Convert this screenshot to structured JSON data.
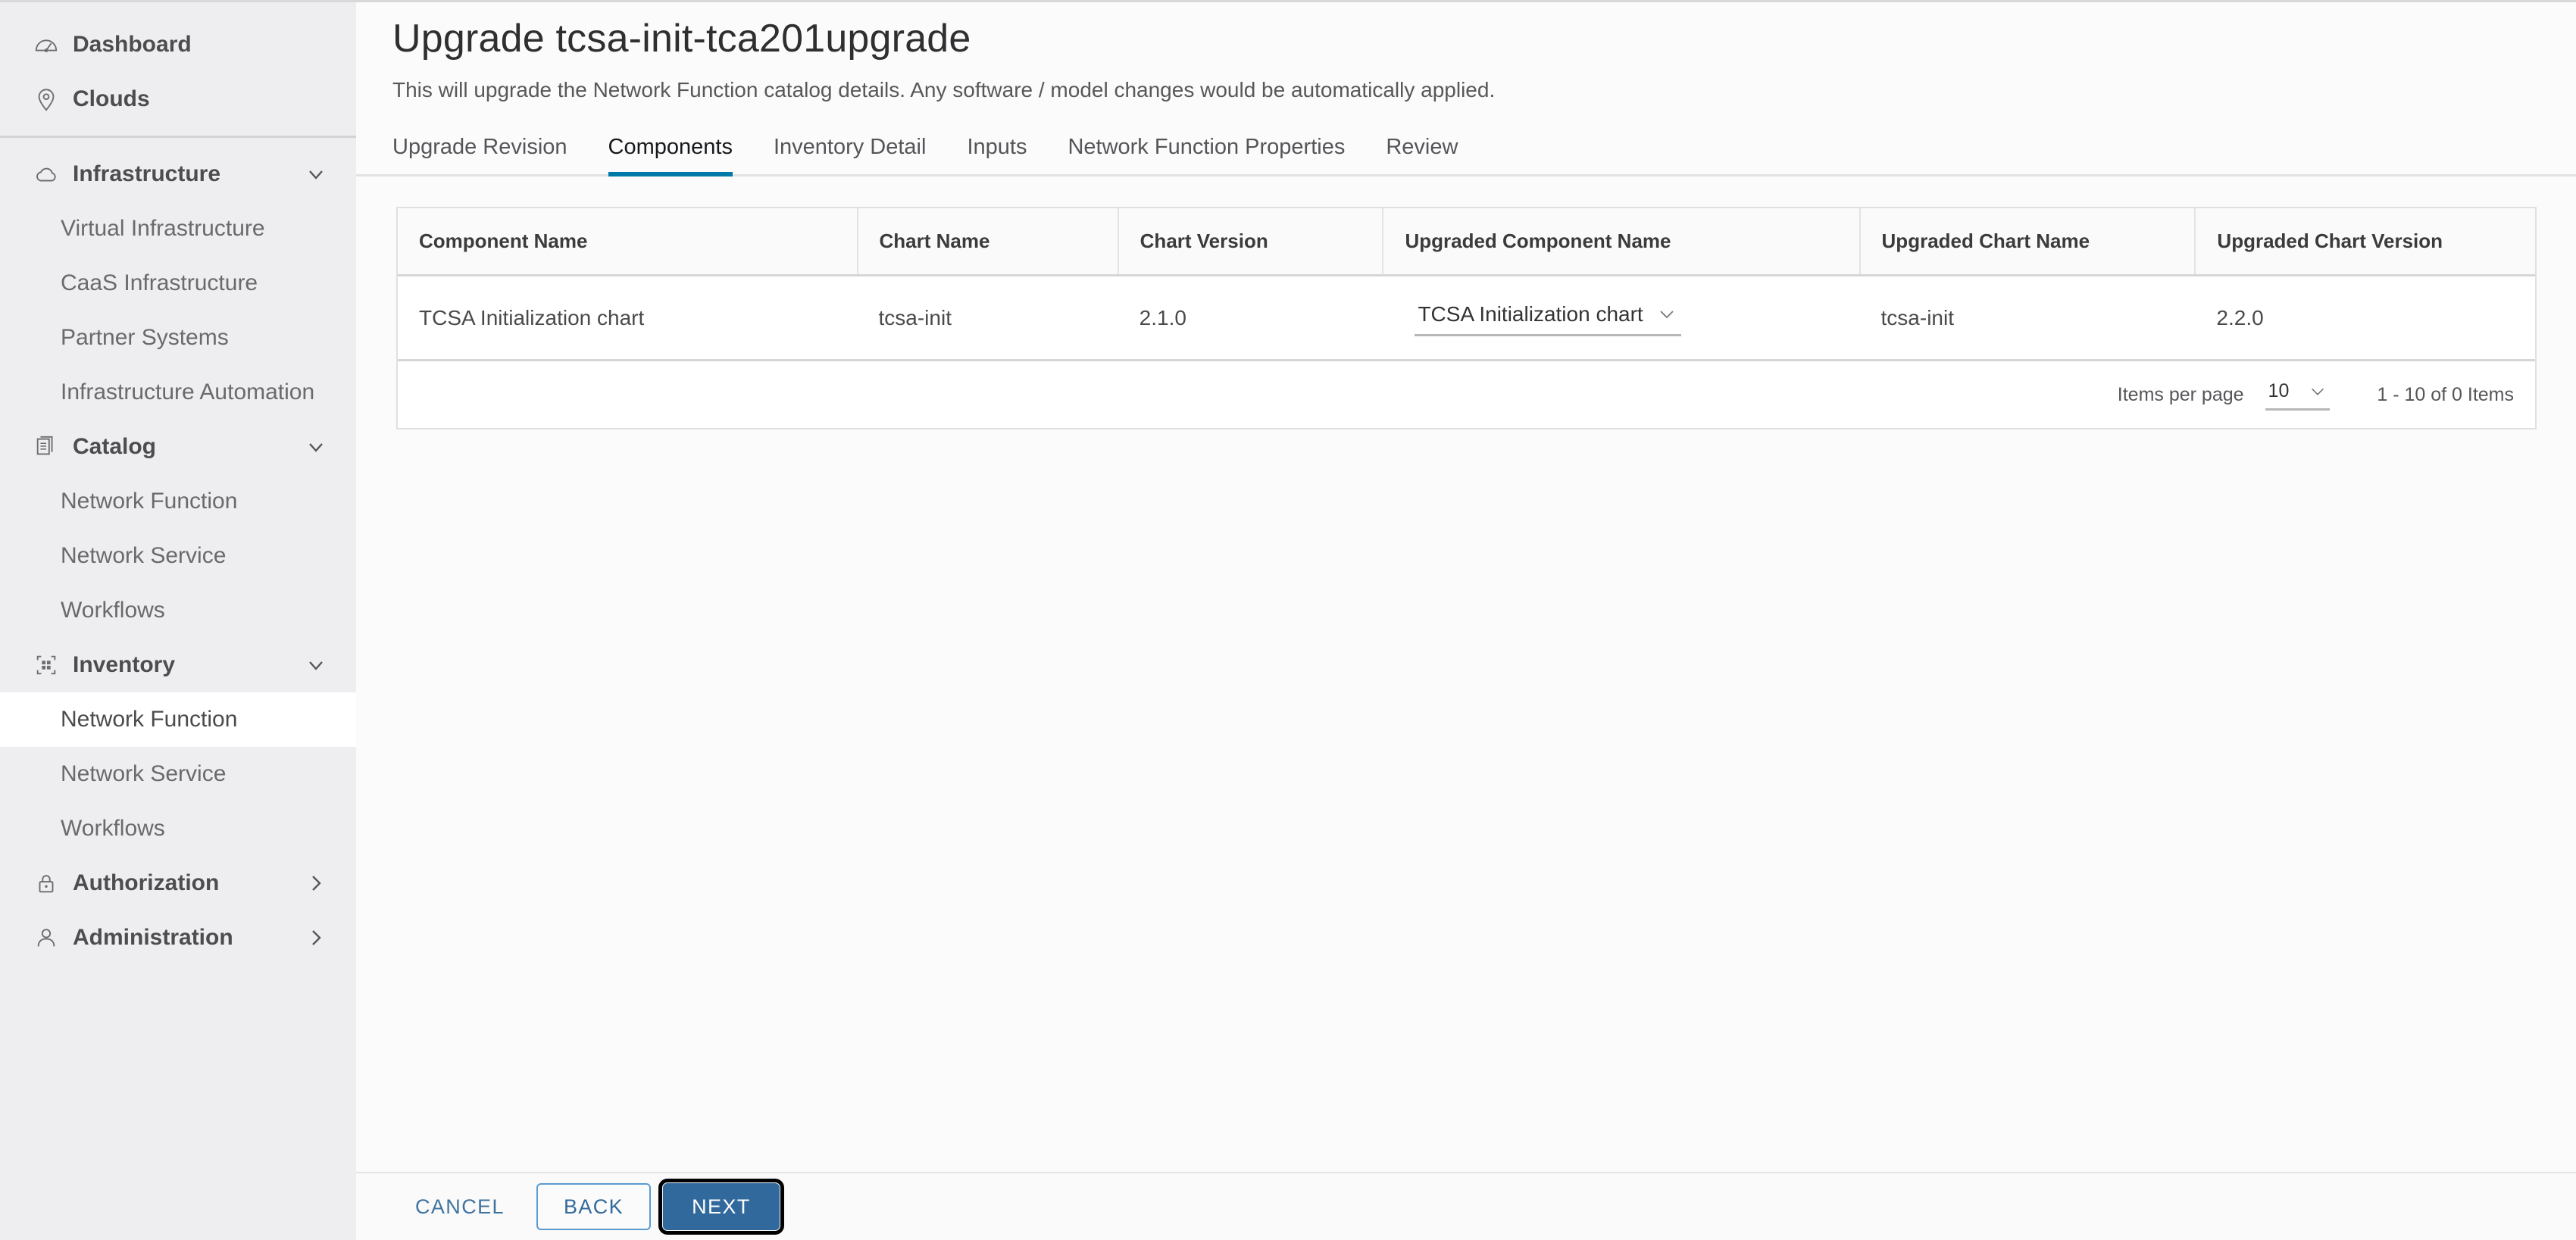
{
  "sidebar": {
    "primary": [
      {
        "label": "Dashboard",
        "icon": "dashboard-icon"
      },
      {
        "label": "Clouds",
        "icon": "location-pin-icon"
      }
    ],
    "sections": [
      {
        "label": "Infrastructure",
        "icon": "cloud-icon",
        "chevron": "chevron-down-icon",
        "expanded": true,
        "items": [
          {
            "label": "Virtual Infrastructure",
            "selected": false
          },
          {
            "label": "CaaS Infrastructure",
            "selected": false
          },
          {
            "label": "Partner Systems",
            "selected": false
          },
          {
            "label": "Infrastructure Automation",
            "selected": false
          }
        ]
      },
      {
        "label": "Catalog",
        "icon": "catalog-icon",
        "chevron": "chevron-down-icon",
        "expanded": true,
        "items": [
          {
            "label": "Network Function",
            "selected": false
          },
          {
            "label": "Network Service",
            "selected": false
          },
          {
            "label": "Workflows",
            "selected": false
          }
        ]
      },
      {
        "label": "Inventory",
        "icon": "inventory-grid-icon",
        "chevron": "chevron-down-icon",
        "expanded": true,
        "items": [
          {
            "label": "Network Function",
            "selected": true
          },
          {
            "label": "Network Service",
            "selected": false
          },
          {
            "label": "Workflows",
            "selected": false
          }
        ]
      },
      {
        "label": "Authorization",
        "icon": "lock-icon",
        "chevron": "chevron-right-icon",
        "expanded": false,
        "items": []
      },
      {
        "label": "Administration",
        "icon": "user-icon",
        "chevron": "chevron-right-icon",
        "expanded": false,
        "items": []
      }
    ]
  },
  "page": {
    "title": "Upgrade tcsa-init-tca201upgrade",
    "subtitle": "This will upgrade the Network Function catalog details. Any software / model changes would be automatically applied."
  },
  "tabs": [
    {
      "label": "Upgrade Revision",
      "active": false
    },
    {
      "label": "Components",
      "active": true
    },
    {
      "label": "Inventory Detail",
      "active": false
    },
    {
      "label": "Inputs",
      "active": false
    },
    {
      "label": "Network Function Properties",
      "active": false
    },
    {
      "label": "Review",
      "active": false
    }
  ],
  "table": {
    "columns": [
      "Component Name",
      "Chart Name",
      "Chart Version",
      "Upgraded Component Name",
      "Upgraded Chart Name",
      "Upgraded Chart Version"
    ],
    "rows": [
      {
        "component_name": "TCSA Initialization chart",
        "chart_name": "tcsa-init",
        "chart_version": "2.1.0",
        "upgraded_component_name": "TCSA Initialization chart",
        "upgraded_chart_name": "tcsa-init",
        "upgraded_chart_version": "2.2.0"
      }
    ],
    "pagination": {
      "items_per_page_label": "Items per page",
      "items_per_page_value": "10",
      "range": "1 - 10 of 0 Items"
    }
  },
  "footer": {
    "cancel_label": "CANCEL",
    "back_label": "BACK",
    "next_label": "NEXT"
  },
  "colors": {
    "accent": "#0078a8",
    "primary_button": "#31699c",
    "link": "#32699c",
    "sidebar_bg": "#eeeef0"
  }
}
